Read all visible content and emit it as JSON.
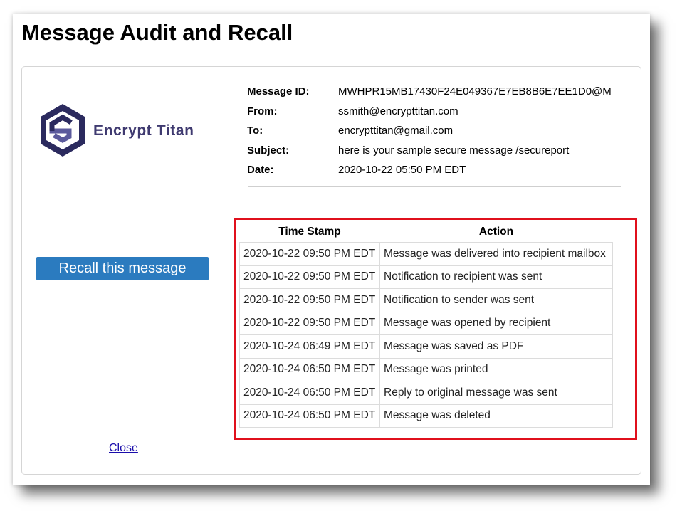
{
  "page_title": "Message Audit and Recall",
  "brand": {
    "name": "Encrypt Titan",
    "logo_icon": "stylized-hexagon-s-logo",
    "colors": {
      "logo_dark": "#2b2a5e",
      "logo_light": "#5b5a9c",
      "text": "#3f3a70"
    }
  },
  "recall_button_label": "Recall this message",
  "close_link_label": "Close",
  "message": {
    "id_label": "Message ID:",
    "id_value": "MWHPR15MB17430F24E049367E7EB8B6E7EE1D0@M",
    "from_label": "From:",
    "from_value": "ssmith@encrypttitan.com",
    "to_label": "To:",
    "to_value": "encrypttitan@gmail.com",
    "subject_label": "Subject:",
    "subject_value": "here is your sample secure message /secureport",
    "date_label": "Date:",
    "date_value": "2020-10-22 05:50 PM EDT"
  },
  "audit_table": {
    "headers": [
      "Time Stamp",
      "Action"
    ],
    "rows": [
      [
        "2020-10-22 09:50 PM EDT",
        "Message was delivered into recipient mailbox"
      ],
      [
        "2020-10-22 09:50 PM EDT",
        "Notification to recipient was sent"
      ],
      [
        "2020-10-22 09:50 PM EDT",
        "Notification to sender was sent"
      ],
      [
        "2020-10-22 09:50 PM EDT",
        "Message was opened by recipient"
      ],
      [
        "2020-10-24 06:49 PM EDT",
        "Message was saved as PDF"
      ],
      [
        "2020-10-24 06:50 PM EDT",
        "Message was printed"
      ],
      [
        "2020-10-24 06:50 PM EDT",
        "Reply to original message was sent"
      ],
      [
        "2020-10-24 06:50 PM EDT",
        "Message was deleted"
      ]
    ]
  },
  "colors": {
    "button": "#2b7bbf",
    "highlight_border": "#e0101c",
    "link": "#1a0dab"
  }
}
